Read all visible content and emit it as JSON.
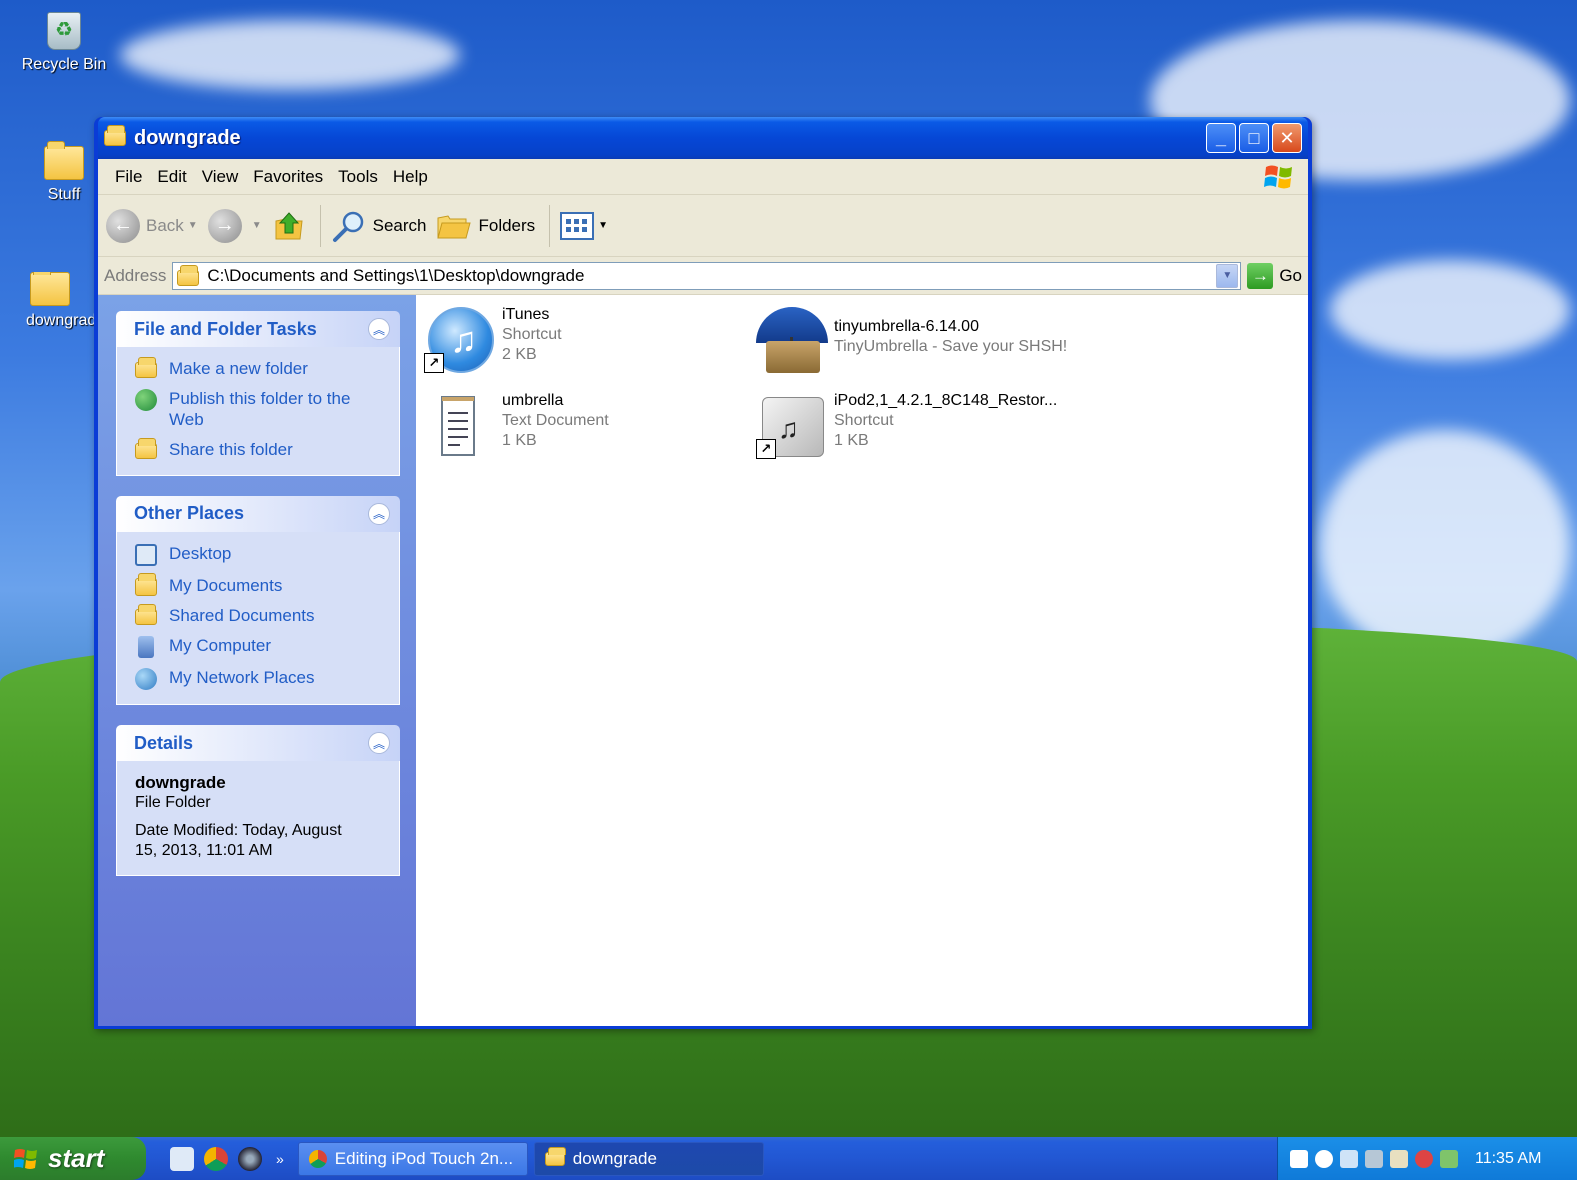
{
  "desktop": {
    "icons": [
      {
        "label": "Recycle Bin"
      },
      {
        "label": "Stuff"
      },
      {
        "label": "downgrad"
      }
    ]
  },
  "window": {
    "title": "downgrade",
    "controls": {
      "minimize": "_",
      "maximize": "□",
      "close": "✕"
    }
  },
  "menubar": {
    "items": [
      "File",
      "Edit",
      "View",
      "Favorites",
      "Tools",
      "Help"
    ]
  },
  "toolbar": {
    "back_label": "Back",
    "search_label": "Search",
    "folders_label": "Folders"
  },
  "address": {
    "label": "Address",
    "value": "C:\\Documents and Settings\\1\\Desktop\\downgrade",
    "go_label": "Go"
  },
  "taskpane": {
    "file_tasks": {
      "title": "File and Folder Tasks",
      "items": [
        "Make a new folder",
        "Publish this folder to the Web",
        "Share this folder"
      ]
    },
    "other_places": {
      "title": "Other Places",
      "items": [
        "Desktop",
        "My Documents",
        "Shared Documents",
        "My Computer",
        "My Network Places"
      ]
    },
    "details": {
      "title": "Details",
      "name": "downgrade",
      "type": "File Folder",
      "modified": "Date Modified: Today, August 15, 2013, 11:01 AM"
    }
  },
  "files": [
    {
      "name": "iTunes",
      "line2": "Shortcut",
      "line3": "2 KB",
      "icon": "itunes-icon",
      "shortcut": true
    },
    {
      "name": "tinyumbrella-6.14.00",
      "line2": "TinyUmbrella - Save your SHSH!",
      "line3": "",
      "icon": "tinyumbrella-icon",
      "shortcut": false
    },
    {
      "name": "umbrella",
      "line2": "Text Document",
      "line3": "1 KB",
      "icon": "text-document-icon",
      "shortcut": false
    },
    {
      "name": "iPod2,1_4.2.1_8C148_Restor...",
      "line2": "Shortcut",
      "line3": "1 KB",
      "icon": "ipsw-icon",
      "shortcut": true
    }
  ],
  "taskbar": {
    "start_label": "start",
    "more_label": "»",
    "tasks": [
      {
        "label": "Editing iPod Touch 2n..."
      },
      {
        "label": "downgrade"
      }
    ],
    "clock": "11:35 AM"
  },
  "colors": {
    "title_blue": "#0a5ae6",
    "task_link": "#215dc6",
    "start_green": "#2f8a2f",
    "tray_blue": "#1b8fe8"
  }
}
